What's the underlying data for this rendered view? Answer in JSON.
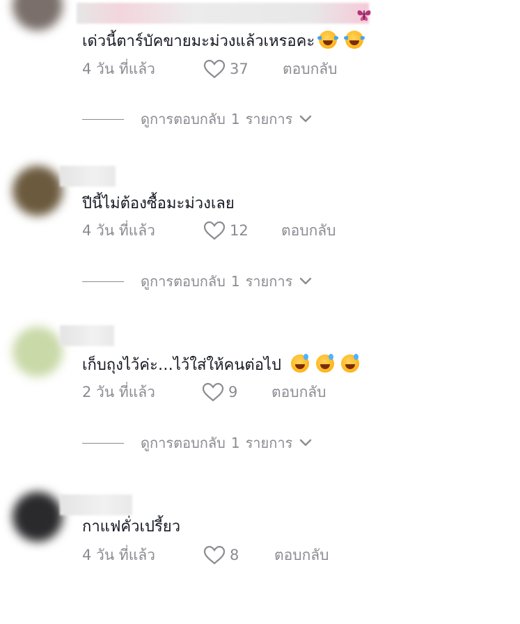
{
  "comments": [
    {
      "text": "เด่วนี้ตาร์บัคขายมะม่วงแล้วเหรอคะ",
      "emojis": [
        "face-with-tears-of-joy-icon",
        "face-with-tears-of-joy-icon"
      ],
      "time": "4 วัน ที่แล้ว",
      "likes": "37",
      "reply": "ตอบกลับ",
      "view_replies": {
        "prefix": "ดูการตอบกลับ",
        "count": "1",
        "suffix": "รายการ"
      }
    },
    {
      "text": "ปีนี้ไม่ต้องซื้อมะม่วงเลย",
      "emojis": [],
      "time": "4 วัน ที่แล้ว",
      "likes": "12",
      "reply": "ตอบกลับ",
      "view_replies": {
        "prefix": "ดูการตอบกลับ",
        "count": "1",
        "suffix": "รายการ"
      }
    },
    {
      "text": "เก็บถุงไว้ค่ะ…ไว้ใส่ให้คนต่อไป",
      "emojis": [
        "grinning-sweat-icon",
        "grinning-sweat-icon",
        "grinning-sweat-icon"
      ],
      "time": "2 วัน ที่แล้ว",
      "likes": "9",
      "reply": "ตอบกลับ",
      "view_replies": {
        "prefix": "ดูการตอบกลับ",
        "count": "1",
        "suffix": "รายการ"
      }
    },
    {
      "text": "กาแฟคั่วเปรี้ยว",
      "emojis": [],
      "time": "4 วัน ที่แล้ว",
      "likes": "8",
      "reply": "ตอบกลับ"
    }
  ],
  "colors": {
    "text": "#161823",
    "muted": "#8a8b91",
    "avatar_1": "#7a6f6a",
    "avatar_2": "#6b5a3e",
    "avatar_3": "#c9d9a8",
    "avatar_4": "#2a2a2c"
  }
}
